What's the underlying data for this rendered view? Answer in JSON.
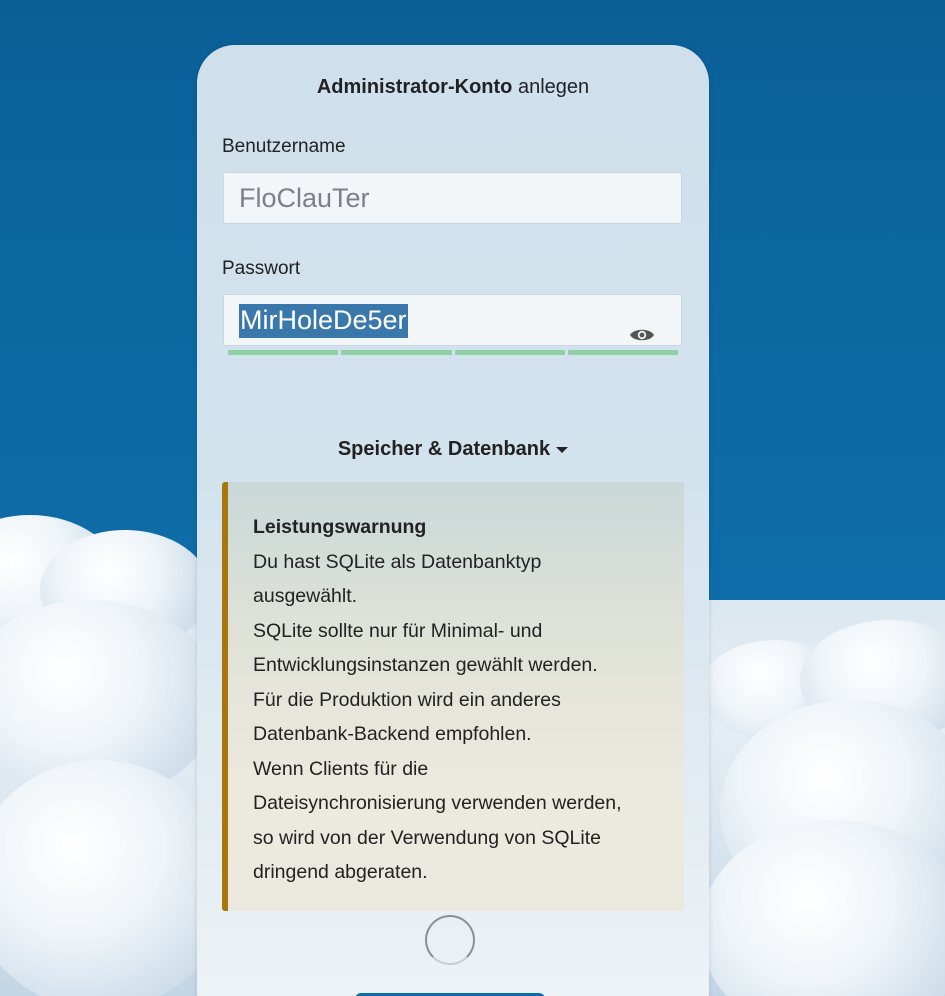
{
  "form": {
    "title_bold": "Administrator-Konto",
    "title_rest": "anlegen",
    "username_label": "Benutzername",
    "username_value": "FloClauTer",
    "password_label": "Passwort",
    "password_value": "MirHoleDe5er",
    "password_strength_segments": 4,
    "password_strength_filled": 4,
    "strength_color": "#8fd0a4"
  },
  "storage_toggle": {
    "label": "Speicher & Datenbank",
    "icon": "caret-down-icon"
  },
  "warning": {
    "title": "Leistungswarnung",
    "lines": [
      "Du hast SQLite als Datenbanktyp",
      "ausgewählt.",
      "SQLite sollte nur für Minimal- und",
      "Entwicklungsinstanzen gewählt werden.",
      "Für die Produktion wird ein anderes",
      "Datenbank-Backend empfohlen.",
      "Wenn Clients für die",
      "Dateisynchronisierung verwenden werden,",
      "so wird von der Verwendung von SQLite",
      "dringend abgeraten."
    ],
    "accent_color": "#a8760a"
  },
  "icons": {
    "password_toggle": "eye-icon",
    "loading": "spinner-icon"
  },
  "colors": {
    "background": "#0d6aa4",
    "selection": "#3a78ac"
  }
}
